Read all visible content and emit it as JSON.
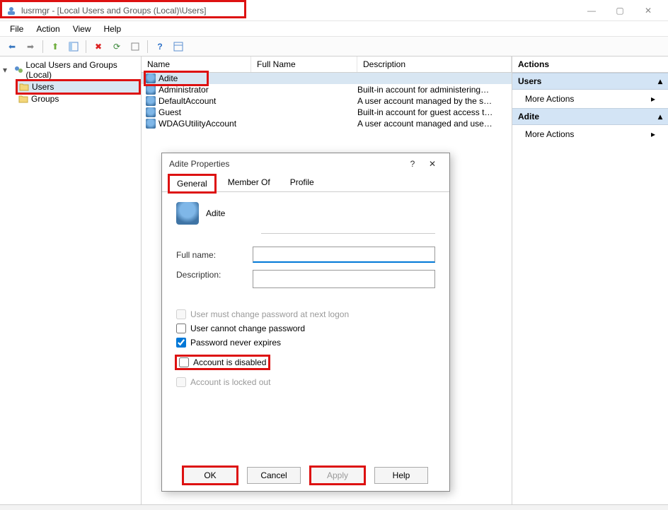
{
  "window": {
    "title": "lusrmgr - [Local Users and Groups (Local)\\Users]"
  },
  "menu": {
    "file": "File",
    "action": "Action",
    "view": "View",
    "help": "Help"
  },
  "tree": {
    "root": "Local Users and Groups (Local)",
    "users": "Users",
    "groups": "Groups"
  },
  "list": {
    "headers": {
      "name": "Name",
      "fullname": "Full Name",
      "description": "Description"
    },
    "rows": [
      {
        "name": "Adite",
        "full": "",
        "desc": ""
      },
      {
        "name": "Administrator",
        "full": "",
        "desc": "Built-in account for administering…"
      },
      {
        "name": "DefaultAccount",
        "full": "",
        "desc": "A user account managed by the s…"
      },
      {
        "name": "Guest",
        "full": "",
        "desc": "Built-in account for guest access t…"
      },
      {
        "name": "WDAGUtilityAccount",
        "full": "",
        "desc": "A user account managed and use…"
      }
    ]
  },
  "actions": {
    "title": "Actions",
    "section1": "Users",
    "more1": "More Actions",
    "section2": "Adite",
    "more2": "More Actions"
  },
  "dialog": {
    "title": "Adite Properties",
    "tabs": {
      "general": "General",
      "member_of": "Member Of",
      "profile": "Profile"
    },
    "username": "Adite",
    "labels": {
      "fullname": "Full name:",
      "description": "Description:"
    },
    "fields": {
      "fullname": "",
      "description": ""
    },
    "checkboxes": {
      "must_change": {
        "label": "User must change password at next logon",
        "checked": false,
        "disabled": true
      },
      "cannot_change": {
        "label": "User cannot change password",
        "checked": false,
        "disabled": false
      },
      "never_expires": {
        "label": "Password never expires",
        "checked": true,
        "disabled": false
      },
      "disabled_acct": {
        "label": "Account is disabled",
        "checked": false,
        "disabled": false
      },
      "locked_out": {
        "label": "Account is locked out",
        "checked": false,
        "disabled": true
      }
    },
    "buttons": {
      "ok": "OK",
      "cancel": "Cancel",
      "apply": "Apply",
      "help": "Help"
    }
  }
}
